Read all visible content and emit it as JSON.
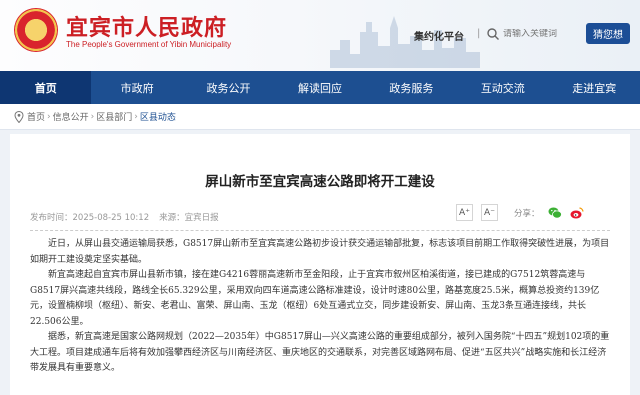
{
  "site": {
    "title": "宜宾市人民政府",
    "subtitle": "The People's Government of Yibin Municipality",
    "elder_mode": "集约化平台",
    "search_placeholder": "请输入关键词",
    "guess_button": "猜您想"
  },
  "nav": {
    "items": [
      {
        "label": "首页",
        "active": true
      },
      {
        "label": "市政府",
        "active": false
      },
      {
        "label": "政务公开",
        "active": false
      },
      {
        "label": "解读回应",
        "active": false
      },
      {
        "label": "政务服务",
        "active": false
      },
      {
        "label": "互动交流",
        "active": false
      },
      {
        "label": "走进宜宾",
        "active": false
      }
    ]
  },
  "breadcrumb": [
    "首页",
    "信息公开",
    "区县部门",
    "区县动态"
  ],
  "article": {
    "title": "屏山新市至宜宾高速公路即将开工建设",
    "publish_time": "发布时间：2025-08-25 10:12",
    "source": "来源：宜宾日报",
    "font_increase": "A⁺",
    "font_decrease": "A⁻",
    "share_label": "分享：",
    "paragraphs": [
      "近日，从屏山县交通运输局获悉，G8517屏山新市至宜宾高速公路初步设计获交通运输部批复，标志该项目前期工作取得突破性进展，为项目如期开工建设奠定坚实基础。",
      "新宜高速起自宜宾市屏山县新市镇，接在建G4216蓉丽高速新市至金阳段，止于宜宾市叙州区柏溪街道，接已建成的G7512筑蓉高速与G8517屏兴高速共线段，路线全长65.329公里，采用双向四车道高速公路标准建设，设计时速80公里，路基宽度25.5米，概算总投资约139亿元，设置楠柳坝（枢纽）、新安、老君山、富荣、屏山南、玉龙（枢纽）6处互通式立交，同步建设新安、屏山南、玉龙3条互通连接线，共长22.506公里。",
      "据悉，新宜高速是国家公路网规划（2022—2035年）中G8517屏山—兴义高速公路的重要组成部分，被列入国务院“十四五”规划102项的重大工程。项目建成通车后将有效加强攀西经济区与川南经济区、重庆地区的交通联系，对完善区域路网布局、促进“五区共兴”战略实施和长江经济带发展具有重要意义。"
    ]
  },
  "colors": {
    "brand_red": "#cc1f24",
    "nav_blue": "#1d4f91",
    "nav_active": "#0e3672"
  }
}
